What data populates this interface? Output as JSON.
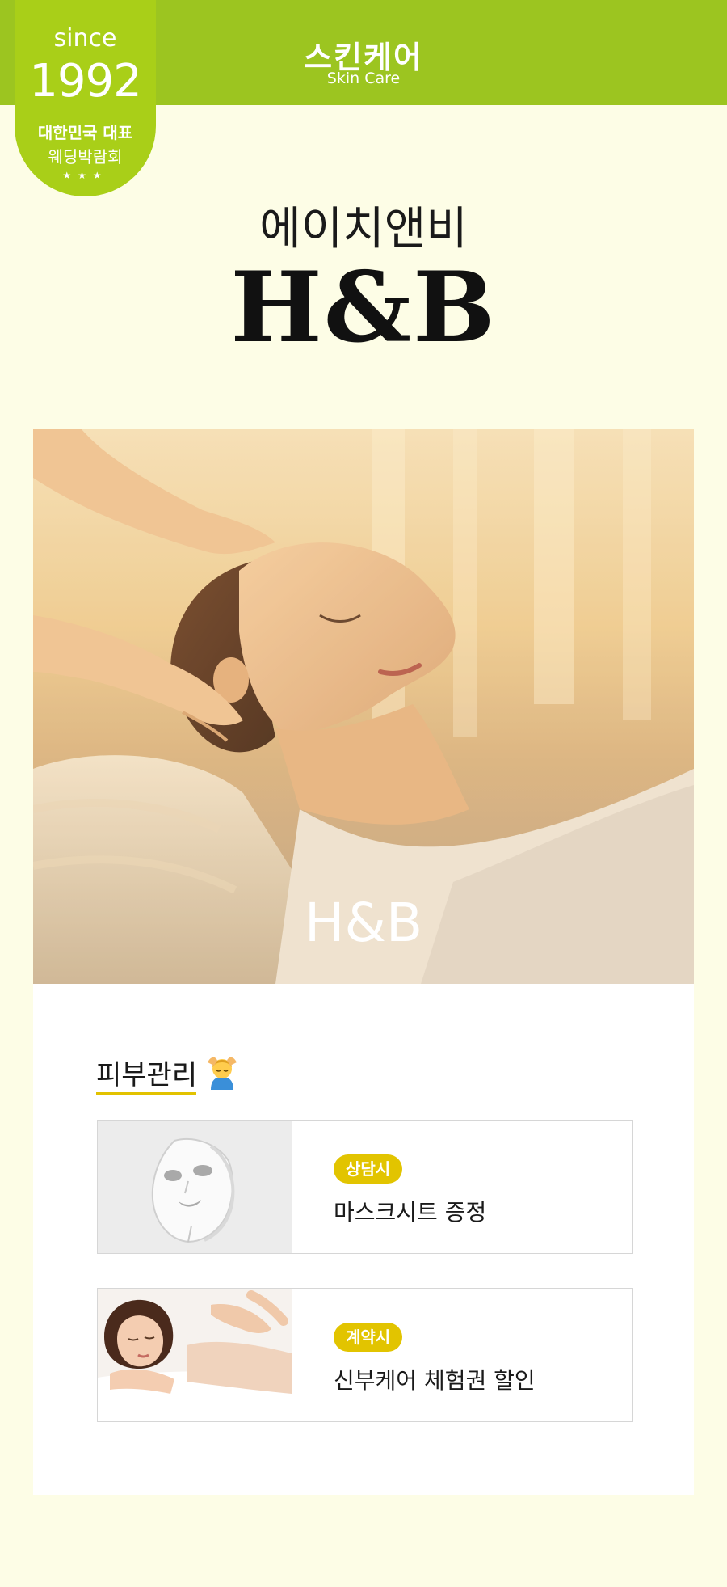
{
  "header": {
    "title": "스킨케어",
    "subtitle": "Skin Care"
  },
  "badge": {
    "since": "since",
    "year": "1992",
    "line1": "대한민국 대표",
    "line2": "웨딩박람회",
    "stars": "★★★"
  },
  "brand": {
    "korean_name": "에이치앤비",
    "english_name": "H&B"
  },
  "hero": {
    "caption": "H&B"
  },
  "section": {
    "title": "피부관리",
    "emoji_icon": "face-massage-icon"
  },
  "benefits": [
    {
      "tag": "상담시",
      "text": "마스크시트 증정",
      "thumb_icon": "sheet-mask-icon"
    },
    {
      "tag": "계약시",
      "text": "신부케어 체험권 할인",
      "thumb_icon": "spa-treatment-photo"
    }
  ],
  "colors": {
    "header_green": "#9cc520",
    "badge_green": "#a9cf18",
    "page_background": "#fdfde6",
    "tag_yellow": "#e2c400"
  }
}
